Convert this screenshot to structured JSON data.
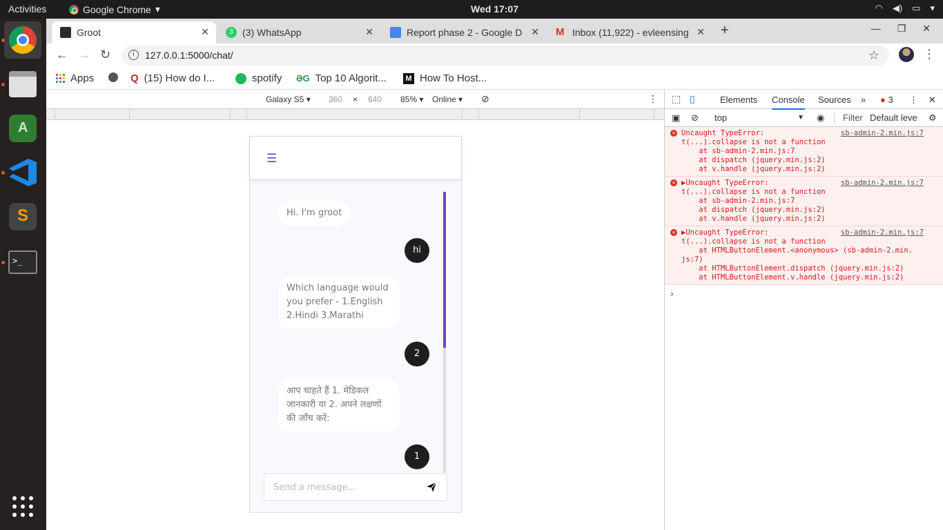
{
  "topbar": {
    "activities": "Activities",
    "app_name": "Google Chrome",
    "clock": "Wed 17:07"
  },
  "tabs": [
    {
      "title": "Groot",
      "favicon": "terminal-icon"
    },
    {
      "title": "(3) WhatsApp",
      "favicon": "whatsapp-icon"
    },
    {
      "title": "Report phase 2 - Google D",
      "favicon": "docs-icon"
    },
    {
      "title": "Inbox (11,922) - evleensing",
      "favicon": "gmail-icon"
    }
  ],
  "omnibox": {
    "url": "127.0.0.1:5000/chat/"
  },
  "bookmarks": [
    {
      "label": "Apps"
    },
    {
      "label": ""
    },
    {
      "label": "(15) How do I..."
    },
    {
      "label": "spotify"
    },
    {
      "label": "Top 10 Algorit..."
    },
    {
      "label": "How To Host..."
    }
  ],
  "device_toolbar": {
    "device": "Galaxy S5",
    "width": "360",
    "x": "×",
    "height": "640",
    "zoom": "85%",
    "network": "Online"
  },
  "chat": {
    "messages": [
      {
        "from": "bot",
        "text": "Hi. I'm groot"
      },
      {
        "from": "user",
        "text": "hi"
      },
      {
        "from": "bot",
        "text": "Which language would you prefer - 1.English 2.Hindi 3.Marathi"
      },
      {
        "from": "user",
        "text": "2"
      },
      {
        "from": "bot",
        "text": "आप चाहते हैं 1. मेडिकल जानकारी या 2. अपने लक्षणों की जाँच करें:"
      },
      {
        "from": "user",
        "text": "1"
      }
    ],
    "input_placeholder": "Send a message..."
  },
  "devtools": {
    "tabs": [
      "Elements",
      "Console",
      "Sources"
    ],
    "active_tab": "Console",
    "error_count": "3",
    "context": "top",
    "filter_placeholder": "Filter",
    "levels": "Default leve",
    "errors": [
      {
        "title": "Uncaught TypeError:",
        "source": "sb-admin-2.min.js:7",
        "body": "t(...).collapse is not a function\n    at sb-admin-2.min.js:7\n    at dispatch (jquery.min.js:2)\n    at v.handle (jquery.min.js:2)"
      },
      {
        "title": "▶Uncaught TypeError:",
        "source": "sb-admin-2.min.js:7",
        "body": "t(...).collapse is not a function\n    at sb-admin-2.min.js:7\n    at dispatch (jquery.min.js:2)\n    at v.handle (jquery.min.js:2)"
      },
      {
        "title": "▶Uncaught TypeError:",
        "source": "sb-admin-2.min.js:7",
        "body": "t(...).collapse is not a function\n    at HTMLButtonElement.<anonymous> (sb-admin-2.min.\njs:7)\n    at HTMLButtonElement.dispatch (jquery.min.js:2)\n    at HTMLButtonElement.v.handle (jquery.min.js:2)"
      }
    ],
    "prompt": "›"
  }
}
